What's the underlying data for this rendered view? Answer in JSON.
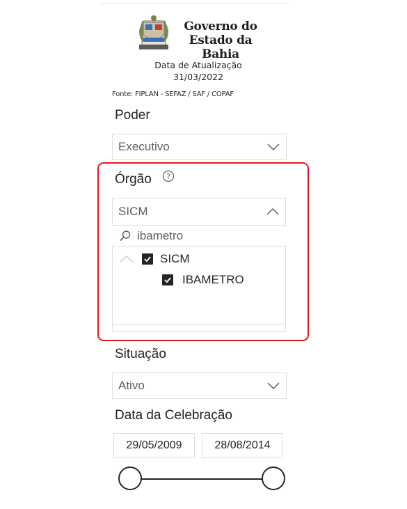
{
  "header": {
    "gov_line1": "Governo do",
    "gov_line2": "Estado da Bahia",
    "update_label": "Data de Atualização",
    "update_date": "31/03/2022",
    "source": "Fonte: FIPLAN - SEFAZ / SAF / COPAF"
  },
  "poder": {
    "title": "Poder",
    "selected": "Executivo"
  },
  "orgao": {
    "title": "Órgão",
    "help_glyph": "?",
    "selected": "SICM",
    "search_value": "ibametro",
    "tree": [
      {
        "label": "SICM",
        "checked": true,
        "level": 0
      },
      {
        "label": "IBAMETRO",
        "checked": true,
        "level": 1
      }
    ]
  },
  "situacao": {
    "title": "Situação",
    "selected": "Ativo"
  },
  "data_celebracao": {
    "title": "Data da Celebração",
    "start": "29/05/2009",
    "end": "28/08/2014"
  },
  "colors": {
    "highlight": "#e5171e",
    "text": "#252423",
    "muted": "#605e5c",
    "border": "#e1dfdd"
  }
}
